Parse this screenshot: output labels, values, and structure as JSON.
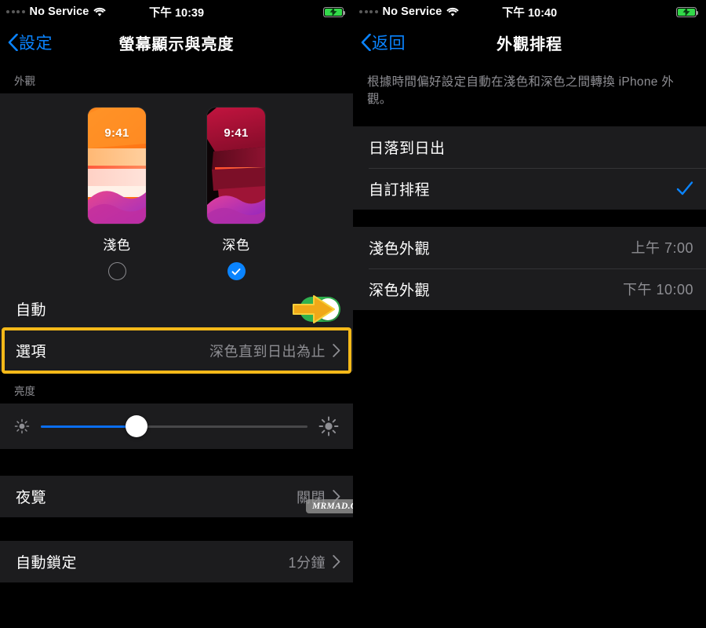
{
  "colors": {
    "accent_blue": "#0a84ff",
    "toggle_green": "#30b14f",
    "highlight_yellow": "#f5b919",
    "group_bg": "#1c1c1e",
    "secondary_text": "#8e8e93"
  },
  "left_screen": {
    "status_bar": {
      "carrier": "No Service",
      "time": "下午 10:39",
      "wifi_icon": "wifi-icon",
      "battery_icon": "battery-charging-icon",
      "signal_icon": "signal-dots-icon"
    },
    "nav": {
      "back_label": "設定",
      "back_icon": "chevron-left-icon",
      "title": "螢幕顯示與亮度"
    },
    "appearance": {
      "section_header": "外觀",
      "options": [
        {
          "name": "淺色",
          "preview_clock": "9:41",
          "selected": false,
          "radio_icon": "radio-unselected-icon"
        },
        {
          "name": "深色",
          "preview_clock": "9:41",
          "selected": true,
          "radio_icon": "radio-checked-icon"
        }
      ],
      "auto_row": {
        "label": "自動",
        "toggle_state": "on",
        "annotation_icon": "yellow-arrow-icon"
      },
      "options_row": {
        "label": "選項",
        "value": "深色直到日出為止",
        "chevron_icon": "chevron-right-icon",
        "highlighted": true
      }
    },
    "brightness": {
      "section_header": "亮度",
      "low_icon": "brightness-low-icon",
      "high_icon": "brightness-high-icon",
      "level_percent": "36"
    },
    "rows": [
      {
        "label": "夜覽",
        "value": "關閉",
        "chevron_icon": "chevron-right-icon"
      },
      {
        "label": "自動鎖定",
        "value": "1分鐘",
        "chevron_icon": "chevron-right-icon"
      }
    ]
  },
  "right_screen": {
    "status_bar": {
      "carrier": "No Service",
      "time": "下午 10:40",
      "wifi_icon": "wifi-icon",
      "battery_icon": "battery-charging-icon",
      "signal_icon": "signal-dots-icon"
    },
    "nav": {
      "back_label": "返回",
      "back_icon": "chevron-left-icon",
      "title": "外觀排程"
    },
    "footnote": "根據時間偏好設定自動在淺色和深色之間轉換 iPhone 外觀。",
    "schedule_options": [
      {
        "label": "日落到日出",
        "selected": false
      },
      {
        "label": "自訂排程",
        "selected": true,
        "check_icon": "checkmark-icon"
      }
    ],
    "time_rows": [
      {
        "label": "淺色外觀",
        "value": "上午 7:00"
      },
      {
        "label": "深色外觀",
        "value": "下午 10:00"
      }
    ]
  },
  "watermark": {
    "text": "MRMAD.COM.TW"
  }
}
